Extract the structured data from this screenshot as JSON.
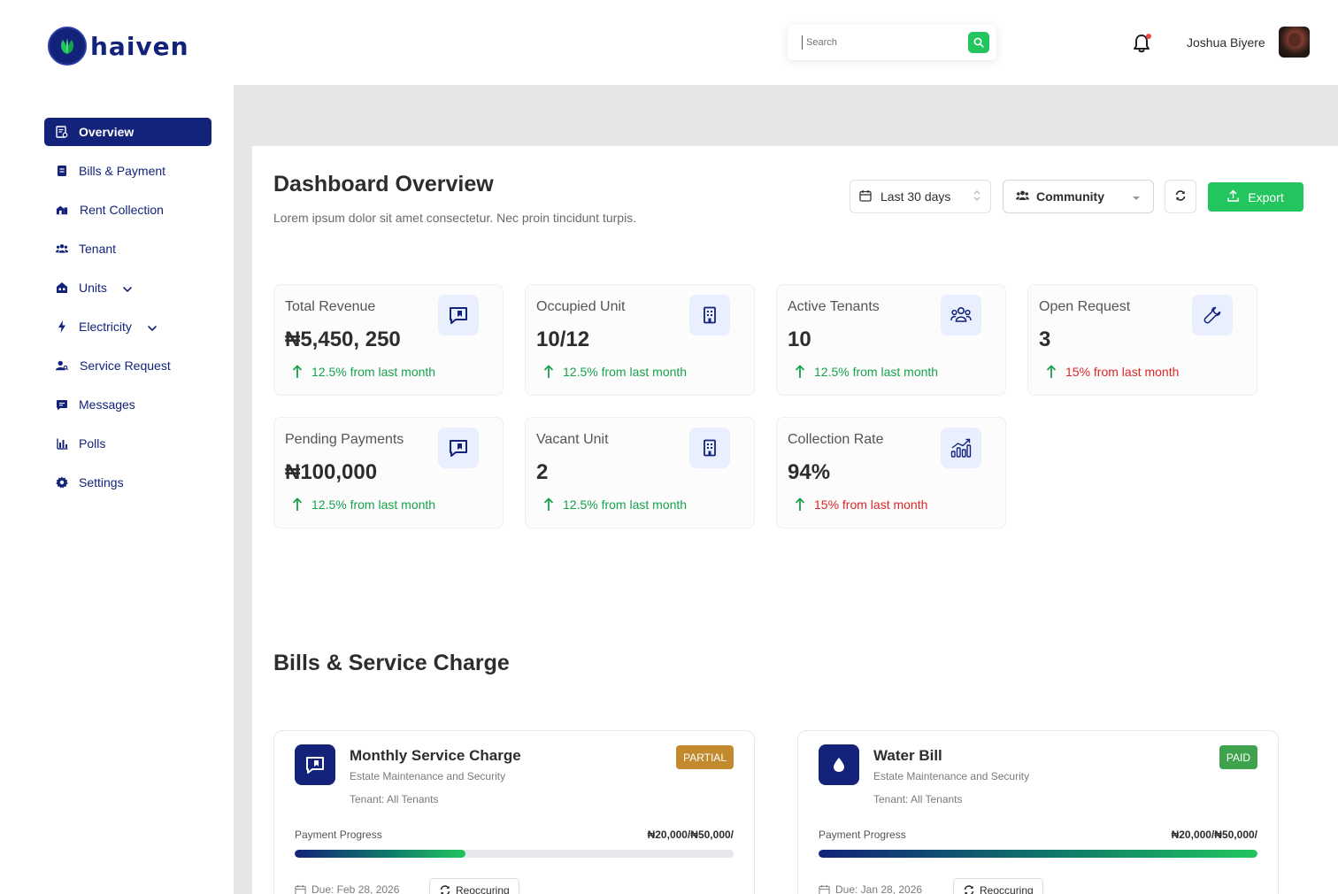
{
  "brand": {
    "name": "haiven",
    "primary": "#13237a",
    "accent": "#22c55e"
  },
  "header": {
    "search_placeholder": "Search",
    "user_name": "Joshua Biyere"
  },
  "sidebar": {
    "items": [
      {
        "label": "Overview",
        "icon": "overview-icon"
      },
      {
        "label": "Bills & Payment",
        "icon": "bills-icon"
      },
      {
        "label": "Rent Collection",
        "icon": "rent-icon"
      },
      {
        "label": "Tenant",
        "icon": "tenant-icon"
      },
      {
        "label": "Units",
        "icon": "units-icon"
      },
      {
        "label": "Electricity",
        "icon": "electricity-icon"
      },
      {
        "label": "Service Request",
        "icon": "service-request-icon"
      },
      {
        "label": "Messages",
        "icon": "messages-icon"
      },
      {
        "label": "Polls",
        "icon": "polls-icon"
      },
      {
        "label": "Settings",
        "icon": "settings-icon"
      }
    ]
  },
  "main": {
    "title": "Dashboard Overview",
    "subtitle": "Lorem ipsum dolor sit amet consectetur. Nec proin tincidunt turpis.",
    "date_range": "Last 30 days",
    "community": "Community",
    "export_label": "Export",
    "stats": [
      {
        "label": "Total Revenue",
        "value": "₦5,450, 250",
        "change": "12.5% from last month",
        "trend": "positive",
        "icon": "message-icon"
      },
      {
        "label": "Occupied Unit",
        "value": "10/12",
        "change": "12.5% from last month",
        "trend": "positive",
        "icon": "building-icon"
      },
      {
        "label": "Active Tenants",
        "value": "10",
        "change": "12.5% from last month",
        "trend": "positive",
        "icon": "users-icon"
      },
      {
        "label": "Open Request",
        "value": "3",
        "change": "15% from last month",
        "trend": "negative",
        "icon": "wrench-icon"
      },
      {
        "label": "Pending Payments",
        "value": "₦100,000",
        "change": "12.5% from last month",
        "trend": "positive",
        "icon": "message-icon"
      },
      {
        "label": "Vacant Unit",
        "value": "2",
        "change": "12.5% from last month",
        "trend": "positive",
        "icon": "building-icon"
      },
      {
        "label": "Collection Rate",
        "value": "94%",
        "change": "15% from last month",
        "trend": "negative",
        "icon": "growth-chart-icon"
      }
    ],
    "bills_title": "Bills & Service Charge",
    "bills": [
      {
        "title": "Monthly Service Charge",
        "subtitle": "Estate Maintenance  and Security",
        "tenant": "Tenant: All Tenants",
        "status": "PARTIAL",
        "progress_label": "Payment Progress",
        "amount": "₦20,000/₦50,000/",
        "progress": 0.39,
        "due": "Due: Feb 28, 2026",
        "recurrence": "Reoccuring",
        "icon": "message-icon"
      },
      {
        "title": "Water Bill",
        "subtitle": "Estate Maintenance  and Security",
        "tenant": "Tenant: All Tenants",
        "status": "PAID",
        "progress_label": "Payment Progress",
        "amount": "₦20,000/₦50,000/",
        "progress": 1.0,
        "due": "Due: Jan 28, 2026",
        "recurrence": "Reoccuring",
        "icon": "water-drop-icon"
      }
    ]
  }
}
